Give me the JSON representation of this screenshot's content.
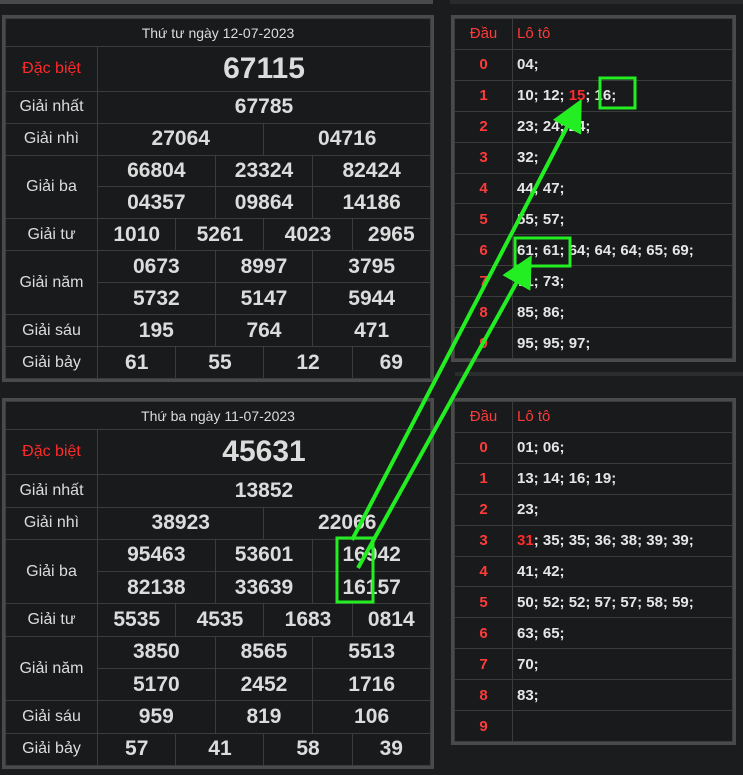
{
  "top": {
    "title": "Thứ tư ngày 12-07-2023",
    "rows": [
      {
        "label": "Đặc biệt",
        "values": [
          "67115"
        ]
      },
      {
        "label": "Giải nhất",
        "values": [
          "67785"
        ]
      },
      {
        "label": "Giải nhì",
        "values": [
          "27064",
          "04716"
        ]
      },
      {
        "label": "Giải ba",
        "values": [
          "66804",
          "23324",
          "82424",
          "04357",
          "09864",
          "14186"
        ]
      },
      {
        "label": "Giải tư",
        "values": [
          "1010",
          "5261",
          "4023",
          "2965"
        ]
      },
      {
        "label": "Giải năm",
        "values": [
          "0673",
          "8997",
          "3795",
          "5732",
          "5147",
          "5944"
        ]
      },
      {
        "label": "Giải sáu",
        "values": [
          "195",
          "764",
          "471"
        ]
      },
      {
        "label": "Giải bảy",
        "values": [
          "61",
          "55",
          "12",
          "69"
        ]
      }
    ]
  },
  "bottom": {
    "title": "Thứ ba ngày 11-07-2023",
    "rows": [
      {
        "label": "Đặc biệt",
        "values": [
          "45631"
        ]
      },
      {
        "label": "Giải nhất",
        "values": [
          "13852"
        ]
      },
      {
        "label": "Giải nhì",
        "values": [
          "38923",
          "22066"
        ]
      },
      {
        "label": "Giải ba",
        "values": [
          "95463",
          "53601",
          "16942",
          "82138",
          "33639",
          "16157"
        ]
      },
      {
        "label": "Giải tư",
        "values": [
          "5535",
          "4535",
          "1683",
          "0814"
        ]
      },
      {
        "label": "Giải năm",
        "values": [
          "3850",
          "8565",
          "5513",
          "5170",
          "2452",
          "1716"
        ]
      },
      {
        "label": "Giải sáu",
        "values": [
          "959",
          "819",
          "106"
        ]
      },
      {
        "label": "Giải bảy",
        "values": [
          "57",
          "41",
          "58",
          "39"
        ]
      }
    ]
  },
  "loto_top": {
    "header_dau": "Đầu",
    "header_loto": "Lô tô",
    "rows": [
      {
        "dau": "0",
        "parts": [
          {
            "t": "04;"
          }
        ]
      },
      {
        "dau": "1",
        "parts": [
          {
            "t": "10; 12; "
          },
          {
            "t": "15",
            "red": true
          },
          {
            "t": "; 16;"
          }
        ]
      },
      {
        "dau": "2",
        "parts": [
          {
            "t": "23; 24; 24;"
          }
        ]
      },
      {
        "dau": "3",
        "parts": [
          {
            "t": "32;"
          }
        ]
      },
      {
        "dau": "4",
        "parts": [
          {
            "t": "44; 47;"
          }
        ]
      },
      {
        "dau": "5",
        "parts": [
          {
            "t": "55; 57;"
          }
        ]
      },
      {
        "dau": "6",
        "parts": [
          {
            "t": "61; 61; 64; 64; 64; 65; 69;"
          }
        ]
      },
      {
        "dau": "7",
        "parts": [
          {
            "t": "71; 73;"
          }
        ]
      },
      {
        "dau": "8",
        "parts": [
          {
            "t": "85; 86;"
          }
        ]
      },
      {
        "dau": "9",
        "parts": [
          {
            "t": "95; 95; 97;"
          }
        ]
      }
    ]
  },
  "loto_bottom": {
    "header_dau": "Đầu",
    "header_loto": "Lô tô",
    "rows": [
      {
        "dau": "0",
        "parts": [
          {
            "t": "01; 06;"
          }
        ]
      },
      {
        "dau": "1",
        "parts": [
          {
            "t": "13; 14; 16; 19;"
          }
        ]
      },
      {
        "dau": "2",
        "parts": [
          {
            "t": "23;"
          }
        ]
      },
      {
        "dau": "3",
        "parts": [
          {
            "t": "31",
            "red": true
          },
          {
            "t": "; 35; 35; 36; 38; 39; 39;"
          }
        ]
      },
      {
        "dau": "4",
        "parts": [
          {
            "t": "41; 42;"
          }
        ]
      },
      {
        "dau": "5",
        "parts": [
          {
            "t": "50; 52; 52; 57; 57; 58; 59;"
          }
        ]
      },
      {
        "dau": "6",
        "parts": [
          {
            "t": "63; 65;"
          }
        ]
      },
      {
        "dau": "7",
        "parts": [
          {
            "t": "70;"
          }
        ]
      },
      {
        "dau": "8",
        "parts": [
          {
            "t": "83;"
          }
        ]
      },
      {
        "dau": "9",
        "parts": []
      }
    ]
  },
  "colors": {
    "accent_red": "#ff1f1f",
    "annotation_green": "#22ee22",
    "background": "#181a1c"
  }
}
